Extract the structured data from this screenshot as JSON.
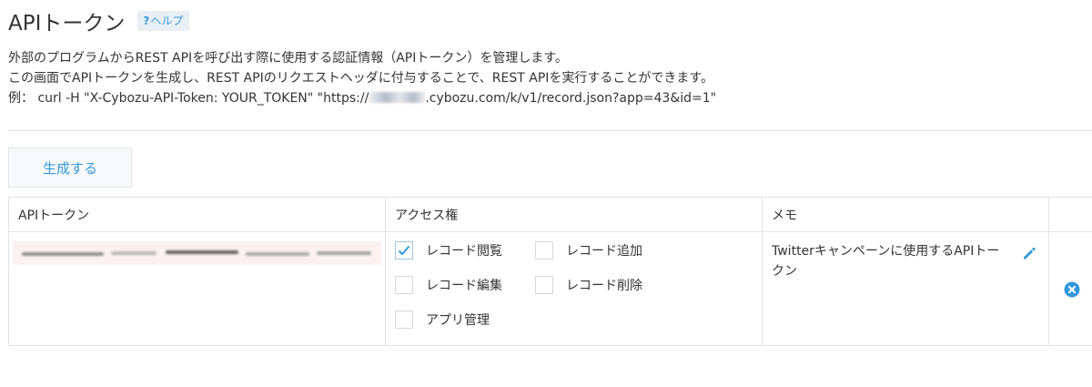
{
  "header": {
    "title": "APIトークン",
    "help_q": "?",
    "help_label": "ヘルプ"
  },
  "description": {
    "line1": "外部のプログラムからREST APIを呼び出す際に使用する認証情報（APIトークン）を管理します。",
    "line2": "この画面でAPIトークンを生成し、REST APIのリクエストヘッダに付与することで、REST APIを実行することができます。",
    "line3_prefix": "例： curl -H \"X-Cybozu-API-Token: YOUR_TOKEN\" \"https://",
    "line3_suffix": ".cybozu.com/k/v1/record.json?app=43&id=1\""
  },
  "generate_button": "生成する",
  "table": {
    "headers": {
      "token": "APIトークン",
      "access": "アクセス権",
      "memo": "メモ",
      "actions": ""
    },
    "row": {
      "permissions": [
        {
          "label": "レコード閲覧",
          "checked": true
        },
        {
          "label": "レコード追加",
          "checked": false
        },
        {
          "label": "レコード編集",
          "checked": false
        },
        {
          "label": "レコード削除",
          "checked": false
        },
        {
          "label": "アプリ管理",
          "checked": false
        }
      ],
      "memo": "Twitterキャンペーンに使用するAPIトークン"
    }
  },
  "icons": {
    "edit": "pencil-icon",
    "delete": "close-circle-icon",
    "check": "checkmark-icon"
  },
  "colors": {
    "accent": "#3498db",
    "border": "#e3e3e3",
    "text": "#333333"
  }
}
